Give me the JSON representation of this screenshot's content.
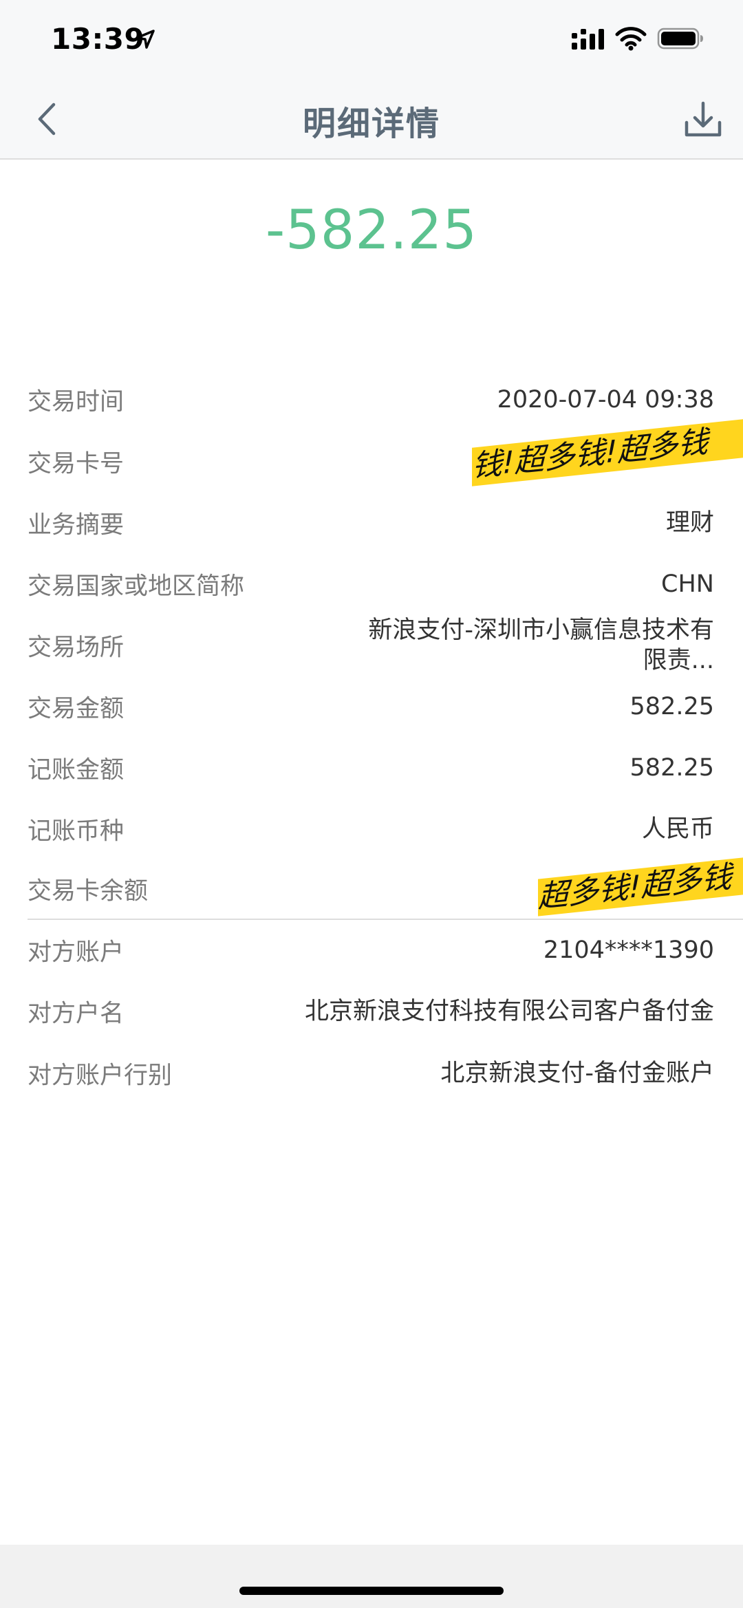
{
  "status_bar": {
    "time": "13:39"
  },
  "nav": {
    "title": "明细详情"
  },
  "amount": "-582.25",
  "details": [
    {
      "label": "交易时间",
      "value": "2020-07-04 09:38"
    },
    {
      "label": "交易卡号",
      "value": "",
      "redacted_text": "钱!超多钱!超多钱"
    },
    {
      "label": "业务摘要",
      "value": "理财"
    },
    {
      "label": "交易国家或地区简称",
      "value": "CHN"
    },
    {
      "label": "交易场所",
      "value": "新浪支付-深圳市小赢信息技术有限责..."
    },
    {
      "label": "交易金额",
      "value": "582.25"
    },
    {
      "label": "记账金额",
      "value": "582.25"
    },
    {
      "label": "记账币种",
      "value": "人民币"
    },
    {
      "label": "交易卡余额",
      "value": "",
      "redacted_text": "超多钱!超多钱"
    }
  ],
  "counterparty": [
    {
      "label": "对方账户",
      "value": "2104****1390"
    },
    {
      "label": "对方户名",
      "value": "北京新浪支付科技有限公司客户备付金"
    },
    {
      "label": "对方账户行别",
      "value": "北京新浪支付-备付金账户"
    }
  ],
  "colors": {
    "amount": "#5cc28f",
    "title": "#5b6a78",
    "label": "#7b7b7b",
    "redaction": "#ffd51e"
  },
  "icons": {
    "back": "chevron-left-icon",
    "download": "download-icon",
    "location": "location-arrow-icon",
    "signal": "cellular-signal-icon",
    "wifi": "wifi-icon",
    "battery": "battery-icon"
  }
}
